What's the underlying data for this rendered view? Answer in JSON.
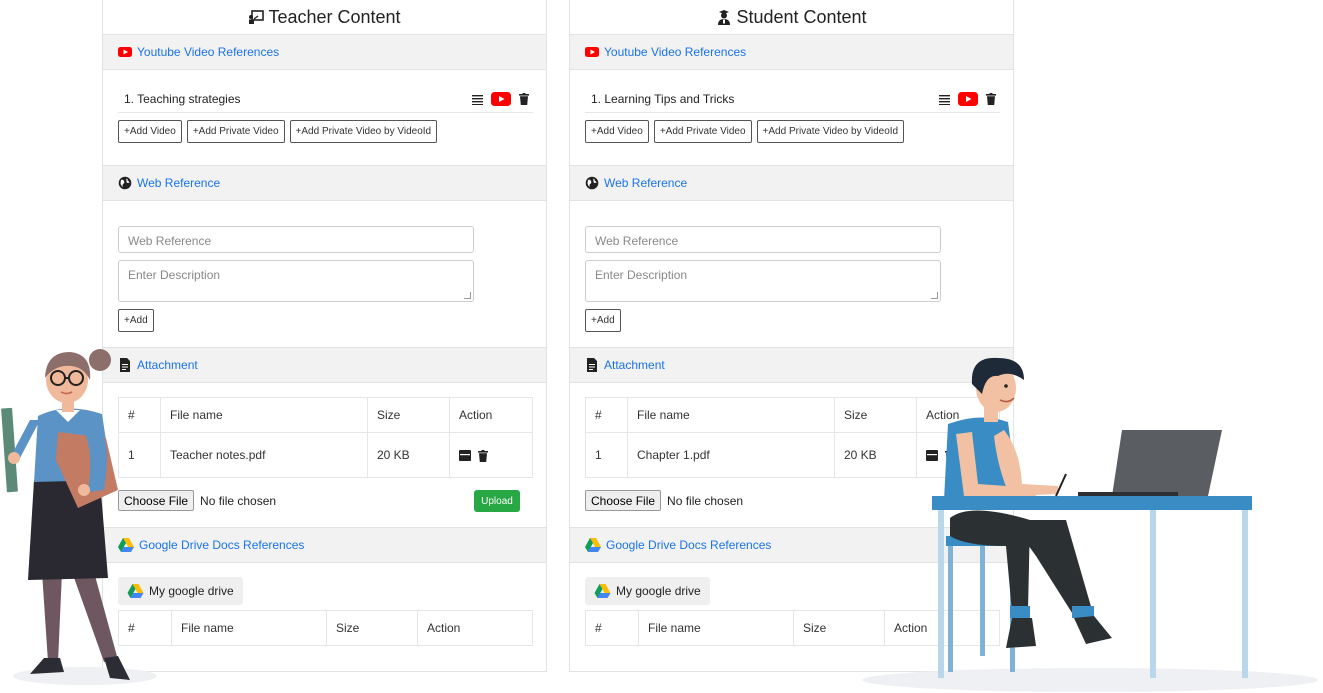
{
  "teacher": {
    "title": "Teacher Content",
    "youtube": {
      "header": "Youtube Video References",
      "item": "1. Teaching strategies",
      "buttons": [
        "+Add Video",
        "+Add Private Video",
        "+Add Private Video by VideoId"
      ]
    },
    "web": {
      "header": "Web Reference",
      "reference_placeholder": "Web Reference",
      "description_placeholder": "Enter Description",
      "add_label": "+Add"
    },
    "attachment": {
      "header": "Attachment",
      "columns": [
        "#",
        "File name",
        "Size",
        "Action"
      ],
      "rows": [
        {
          "num": "1",
          "name": "Teacher notes.pdf",
          "size": "20 KB"
        }
      ],
      "choose_label": "Choose File",
      "no_file": "No file chosen",
      "upload_label": "Upload"
    },
    "gdrive": {
      "header": "Google Drive Docs References",
      "button": "My google drive",
      "columns": [
        "#",
        "File name",
        "Size",
        "Action"
      ]
    }
  },
  "student": {
    "title": "Student Content",
    "youtube": {
      "header": "Youtube Video References",
      "item": "1. Learning Tips and Tricks",
      "buttons": [
        "+Add Video",
        "+Add Private Video",
        "+Add Private Video by VideoId"
      ]
    },
    "web": {
      "header": "Web Reference",
      "reference_placeholder": "Web Reference",
      "description_placeholder": "Enter Description",
      "add_label": "+Add"
    },
    "attachment": {
      "header": "Attachment",
      "columns": [
        "#",
        "File name",
        "Size",
        "Action"
      ],
      "rows": [
        {
          "num": "1",
          "name": "Chapter 1.pdf",
          "size": "20 KB"
        }
      ],
      "choose_label": "Choose File",
      "no_file": "No file chosen"
    },
    "gdrive": {
      "header": "Google Drive Docs References",
      "button": "My google drive",
      "columns": [
        "#",
        "File name",
        "Size",
        "Action"
      ]
    }
  },
  "colors": {
    "link_blue": "#1a73e8",
    "youtube_red": "#ff0000",
    "upload_green": "#28a745",
    "header_bg": "#f2f2f2"
  },
  "icons": {
    "teacher_title": "teacher-board-icon",
    "student_title": "student-icon",
    "youtube": "youtube-icon",
    "web": "globe-icon",
    "attachment": "file-icon",
    "gdrive": "google-drive-icon",
    "row_actions": [
      "list-icon",
      "youtube-play-icon",
      "trash-icon"
    ],
    "file_actions": [
      "download-icon",
      "trash-icon"
    ]
  }
}
